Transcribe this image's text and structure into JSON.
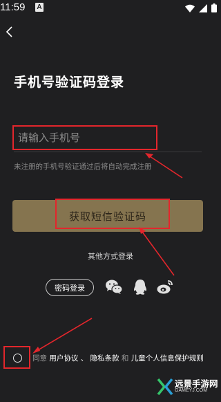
{
  "status_bar": {
    "time": "11:59",
    "notification_badge": "A",
    "icons": [
      "wifi-icon",
      "signal-icon",
      "battery-icon"
    ]
  },
  "nav": {
    "back_icon": "chevron-left-icon"
  },
  "title": "手机号验证码登录",
  "phone_field": {
    "placeholder": "请输入手机号",
    "value": ""
  },
  "hint": "未注册的手机号验证通过后将自动完成注册",
  "code_button": {
    "label": "获取短信验证码"
  },
  "other_login": {
    "label": "其他方式登录",
    "password_button": "密码登录",
    "icons": [
      "wechat-icon",
      "qq-icon",
      "weibo-icon"
    ]
  },
  "agreement": {
    "prefix": "同意",
    "user_agreement": "用户协议",
    "sep1": "、",
    "privacy": "隐私条款",
    "conj": "和",
    "child": "儿童个人信息保护规则",
    "checked": false
  },
  "watermark": {
    "title": "远景手游网",
    "subtitle": "GAMEYJ.COM"
  },
  "colors": {
    "background": "#1f1f21",
    "button": "#85744f",
    "annotation": "#e3262c"
  }
}
